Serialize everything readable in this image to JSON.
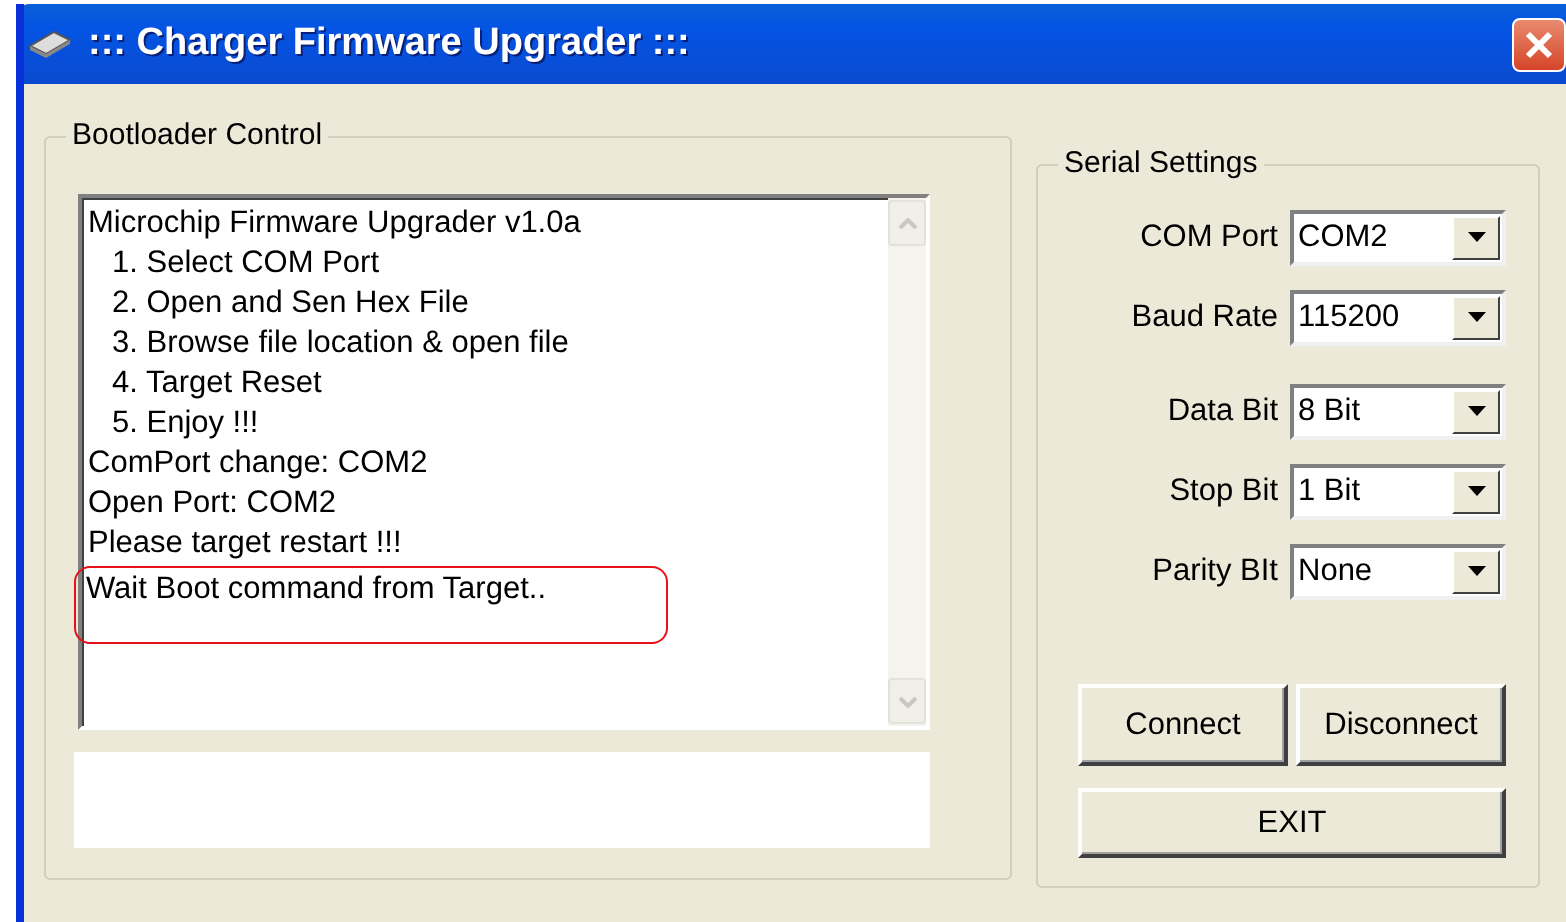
{
  "window": {
    "title": "::: Charger Firmware Upgrader :::"
  },
  "bootloader": {
    "title": "Bootloader Control",
    "log": [
      {
        "text": "Microchip Firmware Upgrader v1.0a",
        "indented": false,
        "highlighted": false
      },
      {
        "text": "1. Select COM Port",
        "indented": true,
        "highlighted": false
      },
      {
        "text": "2. Open and Sen Hex File",
        "indented": true,
        "highlighted": false
      },
      {
        "text": "3. Browse file location & open file",
        "indented": true,
        "highlighted": false
      },
      {
        "text": "4. Target Reset",
        "indented": true,
        "highlighted": false
      },
      {
        "text": "5. Enjoy !!!",
        "indented": true,
        "highlighted": false
      },
      {
        "text": "ComPort change: COM2",
        "indented": false,
        "highlighted": false
      },
      {
        "text": "Open Port: COM2",
        "indented": false,
        "highlighted": false
      },
      {
        "text": "Please target restart !!!",
        "indented": false,
        "highlighted": false
      },
      {
        "text": "Wait Boot command from Target..",
        "indented": false,
        "highlighted": true
      }
    ]
  },
  "serial": {
    "title": "Serial Settings",
    "fields": [
      {
        "label": "COM Port",
        "value": "COM2"
      },
      {
        "label": "Baud Rate",
        "value": "115200"
      },
      {
        "label": "Data Bit",
        "value": "8 Bit"
      },
      {
        "label": "Stop Bit",
        "value": "1 Bit"
      },
      {
        "label": "Parity BIt",
        "value": "None"
      }
    ],
    "buttons": [
      {
        "label": "Connect",
        "wide": false
      },
      {
        "label": "Disconnect",
        "wide": false
      },
      {
        "label": "EXIT",
        "wide": true
      }
    ]
  }
}
